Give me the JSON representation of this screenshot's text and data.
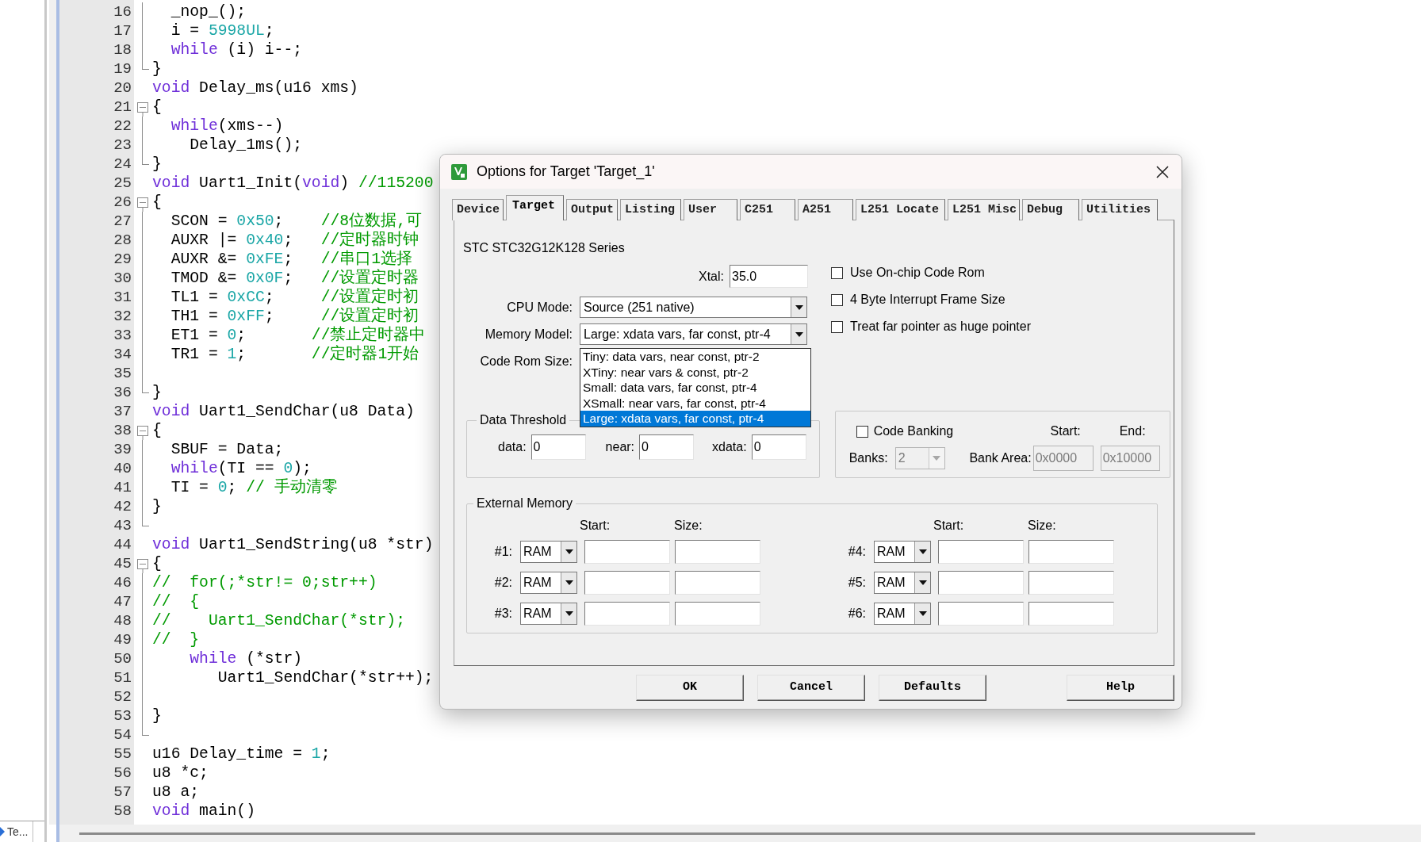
{
  "sidebar": {
    "tab": "Te..."
  },
  "editor": {
    "lines": [
      {
        "number": "16",
        "kind": "line",
        "segments": [
          {
            "kind": "txt",
            "text": "  _nop_();"
          }
        ]
      },
      {
        "number": "17",
        "kind": "line",
        "segments": [
          {
            "kind": "txt",
            "text": "  i = "
          },
          {
            "kind": "num",
            "text": "5998UL"
          },
          {
            "kind": "txt",
            "text": ";"
          }
        ]
      },
      {
        "number": "18",
        "kind": "line",
        "segments": [
          {
            "kind": "kw",
            "text": "  while"
          },
          {
            "kind": "txt",
            "text": " (i) i--;"
          }
        ]
      },
      {
        "number": "19",
        "kind": "end",
        "segments": [
          {
            "kind": "txt",
            "text": "}"
          }
        ]
      },
      {
        "number": "20",
        "kind": "none",
        "segments": [
          {
            "kind": "kw",
            "text": "void"
          },
          {
            "kind": "txt",
            "text": " Delay_ms(u16 xms)"
          }
        ]
      },
      {
        "number": "21",
        "kind": "box",
        "segments": [
          {
            "kind": "txt",
            "text": "{"
          }
        ]
      },
      {
        "number": "22",
        "kind": "line",
        "segments": [
          {
            "kind": "kw",
            "text": "  while"
          },
          {
            "kind": "txt",
            "text": "(xms--)"
          }
        ]
      },
      {
        "number": "23",
        "kind": "line",
        "segments": [
          {
            "kind": "txt",
            "text": "    Delay_1ms();"
          }
        ]
      },
      {
        "number": "24",
        "kind": "end",
        "segments": [
          {
            "kind": "txt",
            "text": "}"
          }
        ]
      },
      {
        "number": "25",
        "kind": "none",
        "segments": [
          {
            "kind": "kw",
            "text": "void"
          },
          {
            "kind": "txt",
            "text": " Uart1_Init("
          },
          {
            "kind": "kw",
            "text": "void"
          },
          {
            "kind": "txt",
            "text": ") "
          },
          {
            "kind": "cmt",
            "text": "//115200"
          }
        ]
      },
      {
        "number": "26",
        "kind": "box",
        "segments": [
          {
            "kind": "txt",
            "text": "{"
          }
        ]
      },
      {
        "number": "27",
        "kind": "line",
        "segments": [
          {
            "kind": "txt",
            "text": "  SCON = "
          },
          {
            "kind": "num",
            "text": "0x50"
          },
          {
            "kind": "txt",
            "text": ";    "
          },
          {
            "kind": "cmt",
            "text": "//8位数据,可"
          }
        ]
      },
      {
        "number": "28",
        "kind": "line",
        "segments": [
          {
            "kind": "txt",
            "text": "  AUXR |= "
          },
          {
            "kind": "num",
            "text": "0x40"
          },
          {
            "kind": "txt",
            "text": ";   "
          },
          {
            "kind": "cmt",
            "text": "//定时器时钟"
          }
        ]
      },
      {
        "number": "29",
        "kind": "line",
        "segments": [
          {
            "kind": "txt",
            "text": "  AUXR &= "
          },
          {
            "kind": "num",
            "text": "0xFE"
          },
          {
            "kind": "txt",
            "text": ";   "
          },
          {
            "kind": "cmt",
            "text": "//串口1选择"
          }
        ]
      },
      {
        "number": "30",
        "kind": "line",
        "segments": [
          {
            "kind": "txt",
            "text": "  TMOD &= "
          },
          {
            "kind": "num",
            "text": "0x0F"
          },
          {
            "kind": "txt",
            "text": ";   "
          },
          {
            "kind": "cmt",
            "text": "//设置定时器"
          }
        ]
      },
      {
        "number": "31",
        "kind": "line",
        "segments": [
          {
            "kind": "txt",
            "text": "  TL1 = "
          },
          {
            "kind": "num",
            "text": "0xCC"
          },
          {
            "kind": "txt",
            "text": ";     "
          },
          {
            "kind": "cmt",
            "text": "//设置定时初"
          }
        ]
      },
      {
        "number": "32",
        "kind": "line",
        "segments": [
          {
            "kind": "txt",
            "text": "  TH1 = "
          },
          {
            "kind": "num",
            "text": "0xFF"
          },
          {
            "kind": "txt",
            "text": ";     "
          },
          {
            "kind": "cmt",
            "text": "//设置定时初"
          }
        ]
      },
      {
        "number": "33",
        "kind": "line",
        "segments": [
          {
            "kind": "txt",
            "text": "  ET1 = "
          },
          {
            "kind": "num",
            "text": "0"
          },
          {
            "kind": "txt",
            "text": ";       "
          },
          {
            "kind": "cmt",
            "text": "//禁止定时器中"
          }
        ]
      },
      {
        "number": "34",
        "kind": "line",
        "segments": [
          {
            "kind": "txt",
            "text": "  TR1 = "
          },
          {
            "kind": "num",
            "text": "1"
          },
          {
            "kind": "txt",
            "text": ";       "
          },
          {
            "kind": "cmt",
            "text": "//定时器1开始"
          }
        ]
      },
      {
        "number": "35",
        "kind": "line"
      },
      {
        "number": "36",
        "kind": "end",
        "segments": [
          {
            "kind": "txt",
            "text": "}"
          }
        ]
      },
      {
        "number": "37",
        "kind": "none",
        "segments": [
          {
            "kind": "kw",
            "text": "void"
          },
          {
            "kind": "txt",
            "text": " Uart1_SendChar(u8 Data)"
          }
        ]
      },
      {
        "number": "38",
        "kind": "box",
        "segments": [
          {
            "kind": "txt",
            "text": "{"
          }
        ]
      },
      {
        "number": "39",
        "kind": "line",
        "segments": [
          {
            "kind": "txt",
            "text": "  SBUF = Data;"
          }
        ]
      },
      {
        "number": "40",
        "kind": "line",
        "segments": [
          {
            "kind": "kw",
            "text": "  while"
          },
          {
            "kind": "txt",
            "text": "(TI == "
          },
          {
            "kind": "num",
            "text": "0"
          },
          {
            "kind": "txt",
            "text": ");"
          }
        ]
      },
      {
        "number": "41",
        "kind": "line",
        "segments": [
          {
            "kind": "txt",
            "text": "  TI = "
          },
          {
            "kind": "num",
            "text": "0"
          },
          {
            "kind": "txt",
            "text": "; "
          },
          {
            "kind": "cmt",
            "text": "// 手动清零"
          }
        ]
      },
      {
        "number": "42",
        "kind": "line",
        "segments": [
          {
            "kind": "txt",
            "text": "}"
          }
        ]
      },
      {
        "number": "43",
        "kind": "end"
      },
      {
        "number": "44",
        "kind": "none",
        "segments": [
          {
            "kind": "kw",
            "text": "void"
          },
          {
            "kind": "txt",
            "text": " Uart1_SendString(u8 *str)"
          }
        ]
      },
      {
        "number": "45",
        "kind": "box",
        "segments": [
          {
            "kind": "txt",
            "text": "{"
          }
        ]
      },
      {
        "number": "46",
        "kind": "line",
        "segments": [
          {
            "kind": "cmt",
            "text": "//  for(;*str!= 0;str++)"
          }
        ]
      },
      {
        "number": "47",
        "kind": "line",
        "segments": [
          {
            "kind": "cmt",
            "text": "//  {"
          }
        ]
      },
      {
        "number": "48",
        "kind": "line",
        "segments": [
          {
            "kind": "cmt",
            "text": "//    Uart1_SendChar(*str);"
          }
        ]
      },
      {
        "number": "49",
        "kind": "line",
        "segments": [
          {
            "kind": "cmt",
            "text": "//  }"
          }
        ]
      },
      {
        "number": "50",
        "kind": "line",
        "segments": [
          {
            "kind": "kw",
            "text": "    while"
          },
          {
            "kind": "txt",
            "text": " (*str)"
          }
        ]
      },
      {
        "number": "51",
        "kind": "line",
        "segments": [
          {
            "kind": "txt",
            "text": "       Uart1_SendChar(*str++);"
          }
        ]
      },
      {
        "number": "52",
        "kind": "line"
      },
      {
        "number": "53",
        "kind": "line",
        "segments": [
          {
            "kind": "txt",
            "text": "}"
          }
        ]
      },
      {
        "number": "54",
        "kind": "end"
      },
      {
        "number": "55",
        "kind": "none",
        "segments": [
          {
            "kind": "txt",
            "text": "u16 Delay_time = "
          },
          {
            "kind": "num",
            "text": "1"
          },
          {
            "kind": "txt",
            "text": ";"
          }
        ]
      },
      {
        "number": "56",
        "kind": "none",
        "segments": [
          {
            "kind": "txt",
            "text": "u8 *c;"
          }
        ]
      },
      {
        "number": "57",
        "kind": "none",
        "segments": [
          {
            "kind": "txt",
            "text": "u8 a;"
          }
        ]
      },
      {
        "number": "58",
        "kind": "none",
        "segments": [
          {
            "kind": "kw",
            "text": "void"
          },
          {
            "kind": "txt",
            "text": " main()"
          }
        ]
      }
    ]
  },
  "dialog": {
    "title": "Options for Target 'Target_1'",
    "tabs": [
      {
        "label": "Device",
        "selected": false
      },
      {
        "label": "Target",
        "selected": true
      },
      {
        "label": "Output",
        "selected": false
      },
      {
        "label": "Listing",
        "selected": false
      },
      {
        "label": "User",
        "selected": false
      },
      {
        "label": "C251",
        "selected": false
      },
      {
        "label": "A251",
        "selected": false
      },
      {
        "label": "L251 Locate",
        "selected": false
      },
      {
        "label": "L251 Misc",
        "selected": false
      },
      {
        "label": "Debug",
        "selected": false
      },
      {
        "label": "Utilities",
        "selected": false
      }
    ],
    "device_name": "STC STC32G12K128 Series",
    "xtal": {
      "label": "Xtal:",
      "value": "35.0"
    },
    "cpu_mode": {
      "label": "CPU Mode:",
      "value": "Source (251 native)"
    },
    "memory_model": {
      "label": "Memory Model:",
      "value": "Large: xdata vars, far const, ptr-4",
      "expanded": true,
      "options": [
        {
          "label": "Tiny: data vars, near const, ptr-2",
          "selected": false
        },
        {
          "label": "XTiny: near vars & const, ptr-2",
          "selected": false
        },
        {
          "label": "Small: data vars, far const, ptr-4",
          "selected": false
        },
        {
          "label": "XSmall: near vars, far const, ptr-4",
          "selected": false
        },
        {
          "label": "Large: xdata vars, far const, ptr-4",
          "selected": true
        }
      ]
    },
    "code_rom_size": {
      "label": "Code Rom Size:"
    },
    "checkboxes": [
      {
        "label": "Use On-chip Code Rom",
        "checked": false
      },
      {
        "label": "4 Byte Interrupt Frame Size",
        "checked": false
      },
      {
        "label": "Treat far pointer as huge pointer",
        "checked": false
      }
    ],
    "data_threshold": {
      "title": "Data Threshold",
      "fields": [
        {
          "label": "data:",
          "value": "0"
        },
        {
          "label": "near:",
          "value": "0"
        },
        {
          "label": "xdata:",
          "value": "0"
        }
      ]
    },
    "code_banking": {
      "label": "Code Banking",
      "checked": false,
      "disabled": true,
      "start_label": "Start:",
      "end_label": "End:",
      "banks_label": "Banks:",
      "banks_value": "2",
      "bank_area_label": "Bank Area:",
      "start_value": "0x0000",
      "end_value": "0x10000"
    },
    "external_memory": {
      "title": "External Memory",
      "headers_left": [
        "Start:",
        "Size:"
      ],
      "headers_right": [
        "Start:",
        "Size:"
      ],
      "rows": [
        {
          "label": "#1:",
          "type": "RAM"
        },
        {
          "label": "#2:",
          "type": "RAM"
        },
        {
          "label": "#3:",
          "type": "RAM"
        },
        {
          "label": "#4:",
          "type": "RAM"
        },
        {
          "label": "#5:",
          "type": "RAM"
        },
        {
          "label": "#6:",
          "type": "RAM"
        }
      ]
    },
    "buttons": [
      "OK",
      "Cancel",
      "Defaults",
      "Help"
    ]
  }
}
